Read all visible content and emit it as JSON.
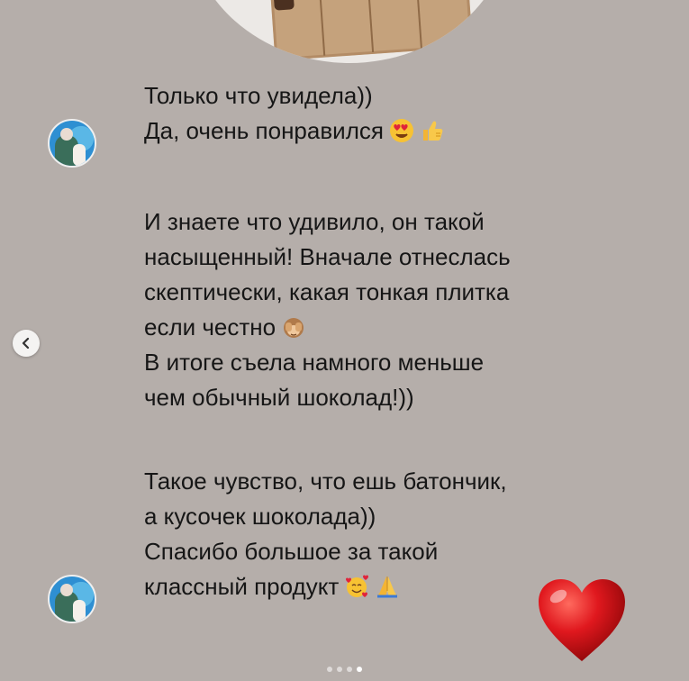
{
  "messages": [
    {
      "lines": [
        "Только что увидела))",
        "Да, очень понравился"
      ],
      "emoji": [
        "heart-eyes-face",
        "thumbs-up"
      ]
    },
    {
      "lines": [
        "И знаете что удивило, он такой",
        "насыщенный! Вначале отнеслась",
        "скептически, какая тонкая плитка",
        "если честно",
        "В итоге съела намного меньше",
        "чем обычный шоколад!))"
      ],
      "emoji": [
        "see-no-evil-monkey"
      ]
    },
    {
      "lines": [
        "Такое чувство, что ешь батончик,",
        "а кусочек шоколада))",
        "Спасибо большое за такой",
        "классный продукт"
      ],
      "emoji": [
        "smiling-face-with-hearts",
        "folded-hands"
      ]
    }
  ],
  "sticker": "red-heart",
  "pagination": {
    "total": 4,
    "active_index": 3
  },
  "colors": {
    "background": "#b5aeaa",
    "text": "#161616",
    "heart": "#d9161b"
  }
}
